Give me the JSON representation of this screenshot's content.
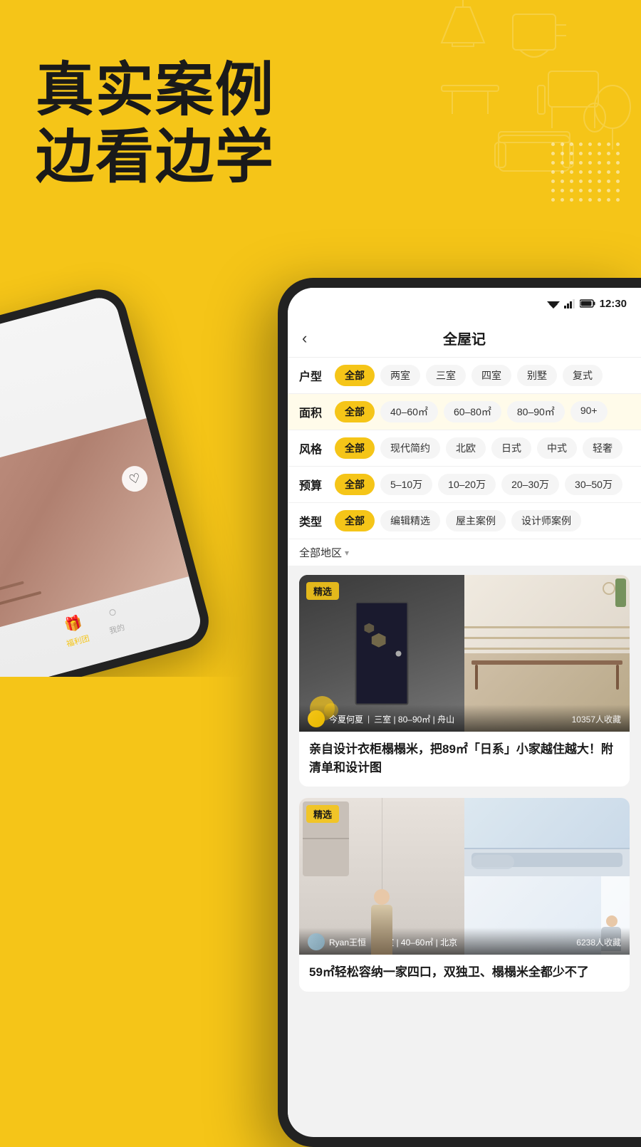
{
  "page": {
    "background_color": "#F5C518"
  },
  "headline": {
    "line1": "真实案例",
    "line2": "边看边学"
  },
  "status_bar": {
    "time": "12:30"
  },
  "nav": {
    "back_icon": "‹",
    "title": "全屋记"
  },
  "filters": [
    {
      "label": "户型",
      "chips": [
        "全部",
        "两室",
        "三室",
        "四室",
        "别墅",
        "复式"
      ],
      "active_index": 0
    },
    {
      "label": "面积",
      "chips": [
        "全部",
        "40–60㎡",
        "60–80㎡",
        "80–90㎡",
        "90+"
      ],
      "active_index": 0,
      "highlighted": true
    },
    {
      "label": "风格",
      "chips": [
        "全部",
        "现代简约",
        "北欧",
        "日式",
        "中式",
        "轻奢"
      ],
      "active_index": 0
    },
    {
      "label": "预算",
      "chips": [
        "全部",
        "5–10万",
        "10–20万",
        "20–30万",
        "30–50万"
      ],
      "active_index": 0
    },
    {
      "label": "类型",
      "chips": [
        "全部",
        "编辑精选",
        "屋主案例",
        "设计师案例"
      ],
      "active_index": 0
    }
  ],
  "region": {
    "label": "全部地区",
    "arrow": "▾"
  },
  "cards": [
    {
      "badge": "精选",
      "meta_author": "今夏何夏",
      "meta_info": "三室 | 80–90㎡ | 舟山",
      "meta_saves": "10357人收藏",
      "title": "亲自设计衣柜榻榻米，把89㎡「日系」小家越住越大！附清单和设计图"
    },
    {
      "badge": "精选",
      "meta_author": "Ryan王恒",
      "meta_info": "一室 | 40–60㎡ | 北京",
      "meta_saves": "6238人收藏",
      "title": "59㎡轻松容纳一家四口，双独卫、榻榻米全都少不了"
    }
  ],
  "phone_left": {
    "tabs": [
      {
        "icon": "🎁",
        "label": "福利团"
      },
      {
        "icon": "○",
        "label": "我的"
      }
    ]
  }
}
